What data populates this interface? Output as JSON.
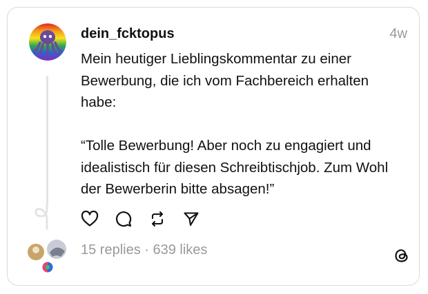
{
  "post": {
    "username": "dein_fcktopus",
    "time": "4w",
    "text": "Mein heutiger Lieblingskommentar zu einer Bewerbung, die ich vom Fachbereich erhalten habe:\n\n“Tolle Bewerbung! Aber noch zu engagiert und idealistisch für diesen Schreibtischjob. Zum Wohl der Bewerberin bitte absagen!”",
    "stats": "15 replies · 639 likes"
  },
  "icons": {
    "like": "heart-icon",
    "comment": "comment-bubble-icon",
    "repost": "repost-icon",
    "share": "send-icon",
    "brand": "threads-logo-icon"
  },
  "colors": {
    "text": "#111111",
    "muted": "#9a9a9a",
    "border": "#d9d9d9"
  }
}
